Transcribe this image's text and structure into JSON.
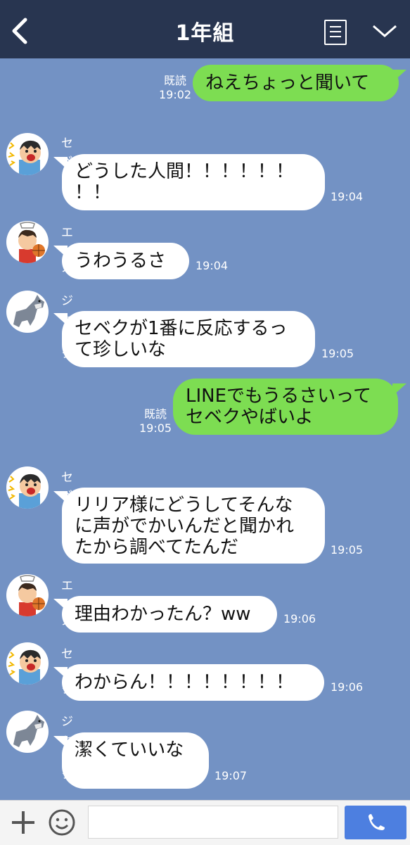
{
  "header": {
    "title": "1年組"
  },
  "messages": [
    {
      "type": "out",
      "text": "ねえちょっと聞いて",
      "read": "既読",
      "time": "19:02"
    },
    {
      "type": "in",
      "sender": "セベク",
      "avatar": "shouting-boy-avatar",
      "text": "どうした人間！！！！！！\n！！",
      "time": "19:04"
    },
    {
      "type": "in",
      "sender": "エース",
      "avatar": "basketball-player-avatar",
      "text": "うわうるさ",
      "time": "19:04"
    },
    {
      "type": "in",
      "sender": "ジャック",
      "avatar": "wolf-avatar",
      "text": "セベクが1番に反応するっ\nて珍しいな",
      "time": "19:05"
    },
    {
      "type": "out",
      "text": "LINEでもうるさいって\nセベクやばいよ",
      "read": "既読",
      "time": "19:05"
    },
    {
      "type": "in",
      "sender": "セベク",
      "avatar": "shouting-boy-avatar",
      "text": "リリア様にどうしてそんな\nに声がでかいんだと聞かれ\nたから調べてたんだ",
      "time": "19:05"
    },
    {
      "type": "in",
      "sender": "エース",
      "avatar": "basketball-player-avatar",
      "text": "理由わかったん？ww",
      "time": "19:06"
    },
    {
      "type": "in",
      "sender": "セベク",
      "avatar": "shouting-boy-avatar",
      "text": "わからん！！！！！！！！",
      "time": "19:06"
    },
    {
      "type": "in",
      "sender": "ジャック",
      "avatar": "wolf-avatar",
      "text": "潔くていいな",
      "time": "19:07"
    }
  ],
  "footer": {
    "input_value": ""
  },
  "colors": {
    "header_bg": "#283550",
    "chat_bg": "#7392c4",
    "out_bubble": "#7ddd52",
    "in_bubble": "#ffffff",
    "call_button": "#4d7fe0"
  }
}
